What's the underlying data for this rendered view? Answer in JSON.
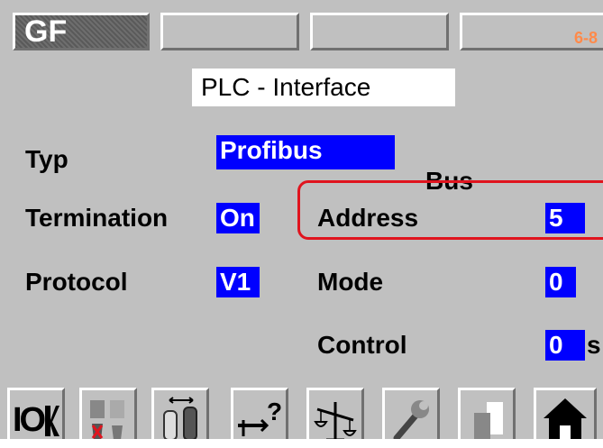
{
  "header": {
    "tab_label": "GF",
    "page_number": "6-8"
  },
  "title": "PLC - Interface",
  "fields": {
    "typ": {
      "label": "Typ",
      "value": "Profibus"
    },
    "termination": {
      "label": "Termination",
      "value": "On"
    },
    "protocol": {
      "label": "Protocol",
      "value": "V1"
    },
    "bus": {
      "label": "Bus"
    },
    "address": {
      "label": "Address",
      "value": "5"
    },
    "mode": {
      "label": "Mode",
      "value": "0"
    },
    "control": {
      "label": "Control",
      "value": "0",
      "unit": "s"
    }
  },
  "toolbar": {
    "io_label": "IO",
    "icons": [
      "io-status-icon",
      "alarm-reset-icon",
      "gas-cylinder-icon",
      "test-query-icon",
      "calibration-scale-icon",
      "wrench-icon",
      "copy-page-icon",
      "home-icon"
    ]
  },
  "colors": {
    "panel": "#c0c0c0",
    "value_bg": "#0000ff",
    "highlight": "#e0141e",
    "page_number": "#ff8a4a"
  }
}
